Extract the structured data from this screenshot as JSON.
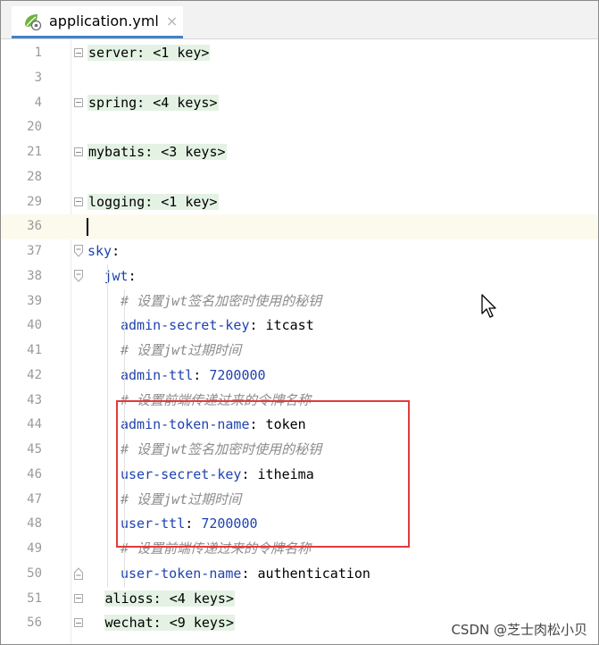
{
  "tab": {
    "title": "application.yml",
    "close": "×"
  },
  "lines": [
    {
      "num": "1",
      "fold": "collapsed",
      "indent": 0,
      "parts": [
        {
          "t": "server: <1 key>",
          "c": "collapsed"
        }
      ]
    },
    {
      "num": "3",
      "fold": "",
      "indent": 0,
      "parts": []
    },
    {
      "num": "4",
      "fold": "collapsed",
      "indent": 0,
      "parts": [
        {
          "t": "spring: <4 keys>",
          "c": "collapsed"
        }
      ]
    },
    {
      "num": "20",
      "fold": "",
      "indent": 0,
      "parts": []
    },
    {
      "num": "21",
      "fold": "collapsed",
      "indent": 0,
      "parts": [
        {
          "t": "mybatis: <3 keys>",
          "c": "collapsed"
        }
      ]
    },
    {
      "num": "28",
      "fold": "",
      "indent": 0,
      "parts": []
    },
    {
      "num": "29",
      "fold": "collapsed",
      "indent": 0,
      "parts": [
        {
          "t": "logging: <1 key>",
          "c": "collapsed"
        }
      ]
    },
    {
      "num": "36",
      "fold": "",
      "indent": 0,
      "parts": [],
      "current": true
    },
    {
      "num": "37",
      "fold": "open",
      "indent": 0,
      "parts": [
        {
          "t": "sky",
          "c": "key"
        },
        {
          "t": ":",
          "c": ""
        }
      ]
    },
    {
      "num": "38",
      "fold": "open",
      "indent": 1,
      "parts": [
        {
          "t": "jwt",
          "c": "key"
        },
        {
          "t": ":",
          "c": ""
        }
      ]
    },
    {
      "num": "39",
      "fold": "",
      "indent": 2,
      "parts": [
        {
          "t": "# 设置jwt签名加密时使用的秘钥",
          "c": "comment"
        }
      ]
    },
    {
      "num": "40",
      "fold": "",
      "indent": 2,
      "parts": [
        {
          "t": "admin-secret-key",
          "c": "key"
        },
        {
          "t": ": itcast",
          "c": ""
        }
      ]
    },
    {
      "num": "41",
      "fold": "",
      "indent": 2,
      "parts": [
        {
          "t": "# 设置jwt过期时间",
          "c": "comment"
        }
      ]
    },
    {
      "num": "42",
      "fold": "",
      "indent": 2,
      "parts": [
        {
          "t": "admin-ttl",
          "c": "key"
        },
        {
          "t": ": ",
          "c": ""
        },
        {
          "t": "7200000",
          "c": "num"
        }
      ]
    },
    {
      "num": "43",
      "fold": "",
      "indent": 2,
      "parts": [
        {
          "t": "# 设置前端传递过来的令牌名称",
          "c": "comment"
        }
      ]
    },
    {
      "num": "44",
      "fold": "",
      "indent": 2,
      "parts": [
        {
          "t": "admin-token-name",
          "c": "key"
        },
        {
          "t": ": token",
          "c": ""
        }
      ]
    },
    {
      "num": "45",
      "fold": "",
      "indent": 2,
      "parts": [
        {
          "t": "# 设置jwt签名加密时使用的秘钥",
          "c": "comment"
        }
      ]
    },
    {
      "num": "46",
      "fold": "",
      "indent": 2,
      "parts": [
        {
          "t": "user-secret-key",
          "c": "key"
        },
        {
          "t": ": itheima",
          "c": ""
        }
      ]
    },
    {
      "num": "47",
      "fold": "",
      "indent": 2,
      "parts": [
        {
          "t": "# 设置jwt过期时间",
          "c": "comment"
        }
      ]
    },
    {
      "num": "48",
      "fold": "",
      "indent": 2,
      "parts": [
        {
          "t": "user-ttl",
          "c": "key"
        },
        {
          "t": ": ",
          "c": ""
        },
        {
          "t": "7200000",
          "c": "num"
        }
      ]
    },
    {
      "num": "49",
      "fold": "",
      "indent": 2,
      "parts": [
        {
          "t": "# 设置前端传递过来的令牌名称",
          "c": "comment"
        }
      ]
    },
    {
      "num": "50",
      "fold": "end",
      "indent": 2,
      "parts": [
        {
          "t": "user-token-name",
          "c": "key"
        },
        {
          "t": ": authentication",
          "c": ""
        }
      ]
    },
    {
      "num": "51",
      "fold": "collapsed",
      "indent": 1,
      "parts": [
        {
          "t": "alioss: <4 keys>",
          "c": "collapsed"
        }
      ]
    },
    {
      "num": "56",
      "fold": "collapsed",
      "indent": 1,
      "parts": [
        {
          "t": "wechat: <9 keys>",
          "c": "collapsed"
        }
      ]
    }
  ],
  "watermark": "CSDN @芝士肉松小贝",
  "colors": {
    "key": "#1f43b0",
    "comment": "#8c8c8c",
    "collapsed_bg": "#e4f2e4",
    "highlight_box": "#e13b3b",
    "tab_underline": "#4083c9"
  },
  "icons": {
    "file": "spring-leaf-yaml-icon",
    "cursor": "mouse-pointer-icon"
  }
}
